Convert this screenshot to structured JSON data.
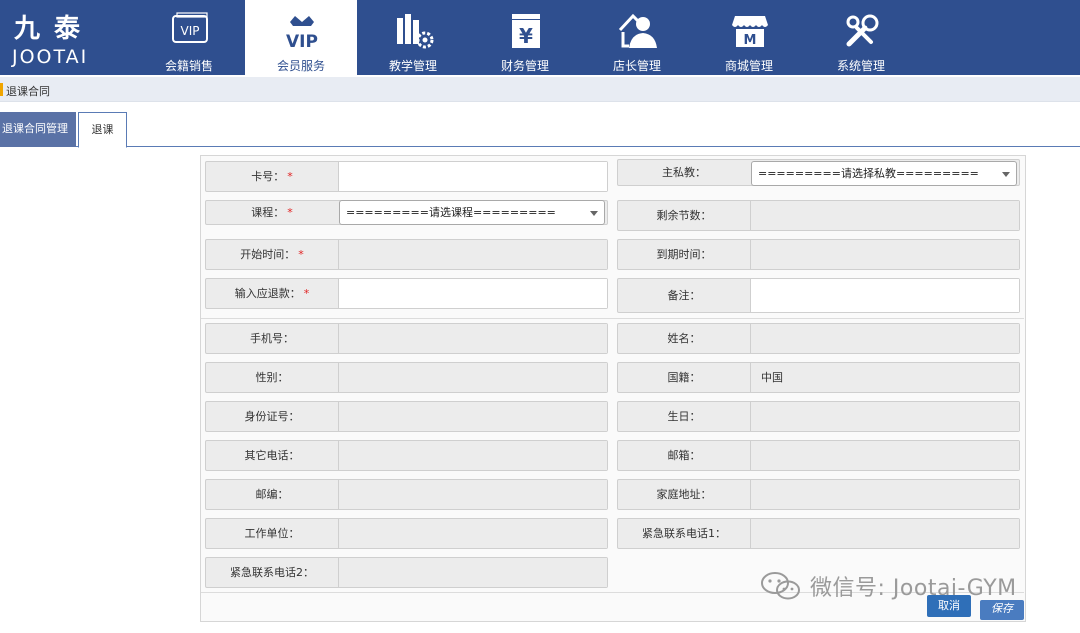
{
  "brand": {
    "cn": "九泰",
    "en": "JOOTAI"
  },
  "nav": [
    {
      "label": "会籍销售",
      "icon": "vip-card-icon"
    },
    {
      "label": "会员服务",
      "icon": "vip-crown-icon",
      "active": true
    },
    {
      "label": "教学管理",
      "icon": "books-gear-icon"
    },
    {
      "label": "财务管理",
      "icon": "yen-icon"
    },
    {
      "label": "店长管理",
      "icon": "manager-icon"
    },
    {
      "label": "商城管理",
      "icon": "store-icon"
    },
    {
      "label": "系统管理",
      "icon": "tools-icon"
    }
  ],
  "breadcrumb": "退课合同",
  "tabs": [
    {
      "label": "退课合同管理"
    },
    {
      "label": "退课",
      "active": true
    }
  ],
  "form": {
    "card_no": {
      "label": "卡号：",
      "value": ""
    },
    "coach": {
      "label": "主私教：",
      "value": "=========请选择私教========="
    },
    "course": {
      "label": "课程：",
      "value": "=========请选课程========="
    },
    "remaining": {
      "label": "剩余节数：",
      "value": ""
    },
    "start_time": {
      "label": "开始时间：",
      "value": ""
    },
    "expire_time": {
      "label": "到期时间：",
      "value": ""
    },
    "refund": {
      "label": "输入应退款：",
      "value": ""
    },
    "remark": {
      "label": "备注：",
      "value": ""
    },
    "phone": {
      "label": "手机号：",
      "value": ""
    },
    "name": {
      "label": "姓名：",
      "value": ""
    },
    "gender": {
      "label": "性别：",
      "value": ""
    },
    "nationality": {
      "label": "国籍：",
      "value": "中国"
    },
    "id_no": {
      "label": "身份证号：",
      "value": ""
    },
    "birthday": {
      "label": "生日：",
      "value": ""
    },
    "other_phone": {
      "label": "其它电话：",
      "value": ""
    },
    "email": {
      "label": "邮箱：",
      "value": ""
    },
    "postcode": {
      "label": "邮编：",
      "value": ""
    },
    "address": {
      "label": "家庭地址：",
      "value": ""
    },
    "employer": {
      "label": "工作单位：",
      "value": ""
    },
    "emergency1": {
      "label": "紧急联系电话1：",
      "value": ""
    },
    "emergency2": {
      "label": "紧急联系电话2：",
      "value": ""
    },
    "required_mark": "*"
  },
  "buttons": {
    "cancel": "取消",
    "save": "保存"
  },
  "watermark": "微信号: Jootai-GYM"
}
